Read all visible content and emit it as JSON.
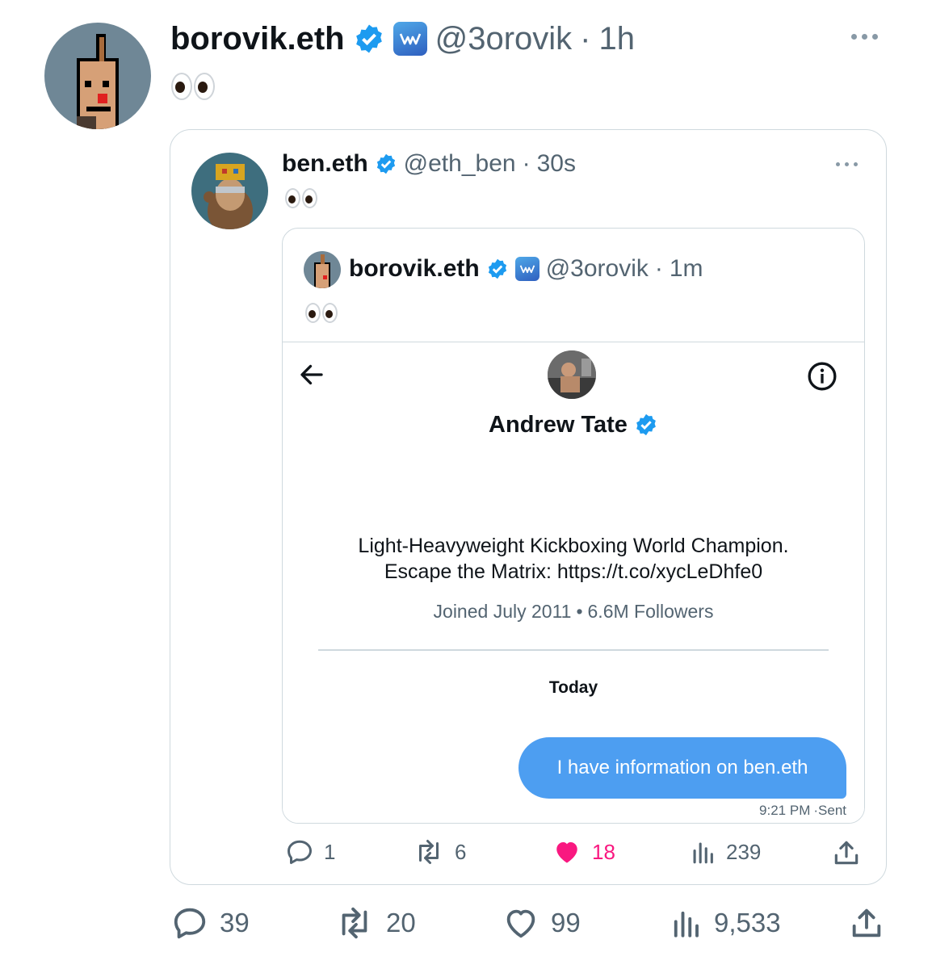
{
  "main_tweet": {
    "display_name": "borovik.eth",
    "handle": "@3orovik",
    "separator": "·",
    "time": "1h",
    "stats": {
      "replies": "39",
      "retweets": "20",
      "likes": "99",
      "views": "9,533"
    }
  },
  "quoted_tweet": {
    "display_name": "ben.eth",
    "handle": "@eth_ben",
    "separator": "·",
    "time": "30s",
    "stats": {
      "replies": "1",
      "retweets": "6",
      "likes": "18",
      "views": "239"
    }
  },
  "nested_quote": {
    "display_name": "borovik.eth",
    "handle": "@3orovik",
    "separator": "·",
    "time": "1m"
  },
  "dm_screenshot": {
    "profile_name": "Andrew Tate",
    "bio_line1": "Light-Heavyweight Kickboxing World Champion.",
    "bio_line2": "Escape the Matrix: https://t.co/xycLeDhfe0",
    "joined": "Joined July 2011",
    "meta_separator": "•",
    "followers": "6.6M Followers",
    "day_label": "Today",
    "message_text": "I have information on ben.eth",
    "message_time": "9:21 PM",
    "message_status": "·Sent"
  },
  "colors": {
    "verified_blue": "#1d9bf0",
    "like_pink": "#f91880",
    "dm_bubble": "#4d9ef1"
  }
}
